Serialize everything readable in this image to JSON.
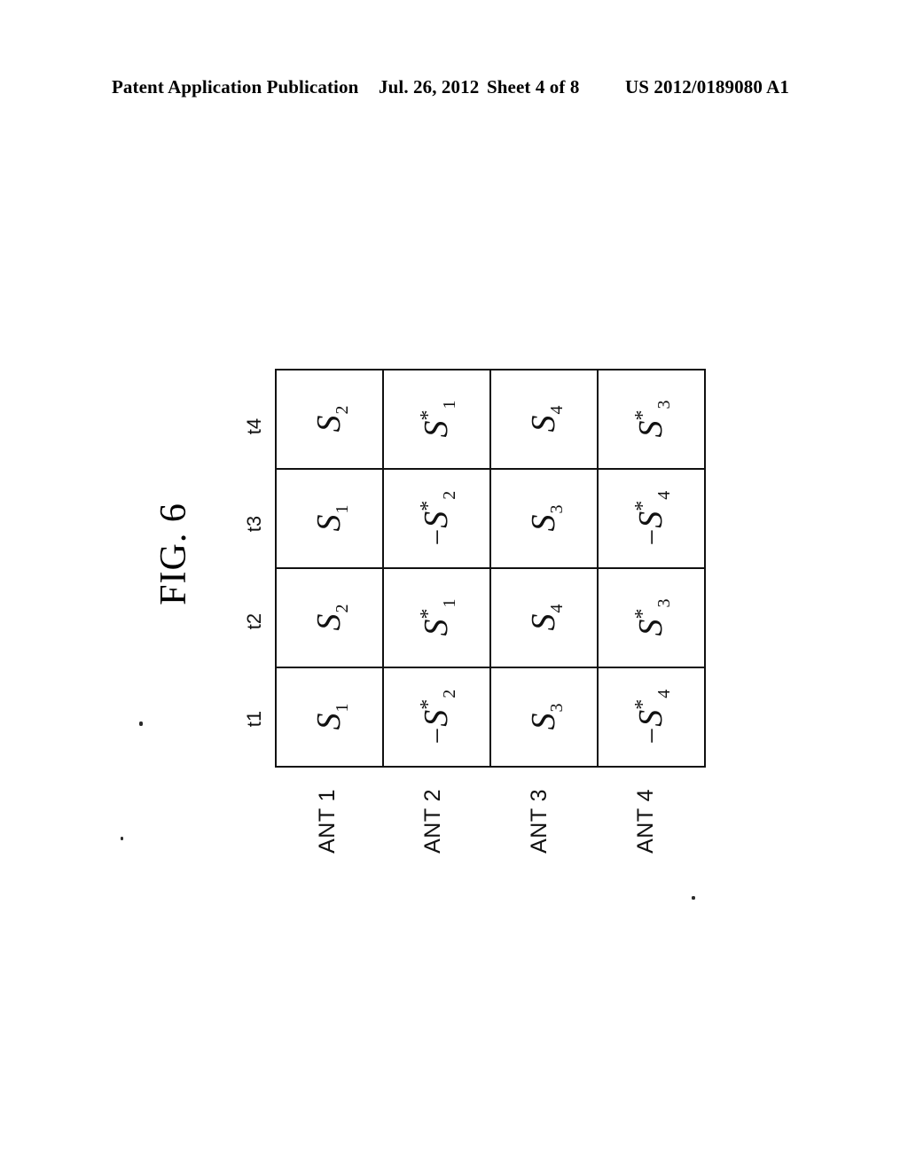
{
  "header": {
    "publication": "Patent Application Publication",
    "date": "Jul. 26, 2012",
    "sheet": "Sheet 4 of 8",
    "patent_number": "US 2012/0189080 A1"
  },
  "figure": {
    "label": "FIG. 6",
    "time_headers": [
      "t1",
      "t2",
      "t3",
      "t4"
    ],
    "antenna_labels": [
      "ANT 1",
      "ANT 2",
      "ANT 3",
      "ANT 4"
    ],
    "cells": [
      [
        {
          "neg": "",
          "base": "S",
          "sub": "1",
          "star": ""
        },
        {
          "neg": "",
          "base": "S",
          "sub": "2",
          "star": ""
        },
        {
          "neg": "",
          "base": "S",
          "sub": "1",
          "star": ""
        },
        {
          "neg": "",
          "base": "S",
          "sub": "2",
          "star": ""
        }
      ],
      [
        {
          "neg": "−",
          "base": "S",
          "sub": "2",
          "star": "*"
        },
        {
          "neg": "",
          "base": "S",
          "sub": "1",
          "star": "*"
        },
        {
          "neg": "−",
          "base": "S",
          "sub": "2",
          "star": "*"
        },
        {
          "neg": "",
          "base": "S",
          "sub": "1",
          "star": "*"
        }
      ],
      [
        {
          "neg": "",
          "base": "S",
          "sub": "3",
          "star": ""
        },
        {
          "neg": "",
          "base": "S",
          "sub": "4",
          "star": ""
        },
        {
          "neg": "",
          "base": "S",
          "sub": "3",
          "star": ""
        },
        {
          "neg": "",
          "base": "S",
          "sub": "4",
          "star": ""
        }
      ],
      [
        {
          "neg": "−",
          "base": "S",
          "sub": "4",
          "star": "*"
        },
        {
          "neg": "",
          "base": "S",
          "sub": "3",
          "star": "*"
        },
        {
          "neg": "−",
          "base": "S",
          "sub": "4",
          "star": "*"
        },
        {
          "neg": "",
          "base": "S",
          "sub": "3",
          "star": "*"
        }
      ]
    ]
  },
  "colors": {
    "ink": "#111111",
    "page": "#ffffff"
  }
}
